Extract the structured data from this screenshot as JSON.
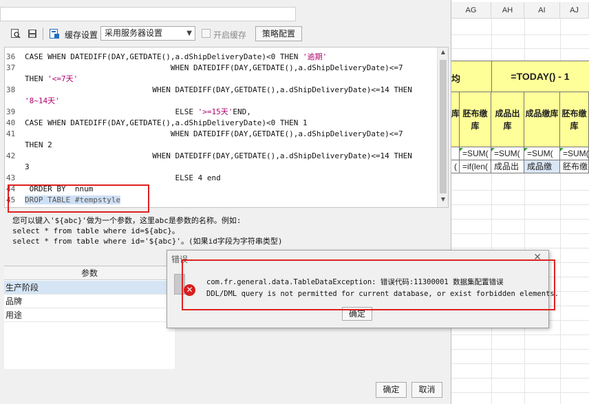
{
  "spreadsheet": {
    "columns": [
      "AG",
      "AH",
      "AI",
      "AJ"
    ],
    "merged_header_left": "均",
    "merged_header_right": "=TODAY() - 1",
    "header_cells": [
      "库",
      "胚布缴库",
      "成品出库",
      "成品缴库",
      "胚布缴库"
    ],
    "formula_row": [
      "",
      "=SUM(",
      "=SUM(",
      "=SUM(",
      "=SUM("
    ],
    "formula_row2": [
      "(",
      "=if(len(",
      "成品出",
      "成品缴",
      "胚布缴"
    ]
  },
  "toolbar": {
    "cache_label": "缓存设置",
    "cache_select": "采用服务器设置",
    "enable_cache_label": "开启缓存",
    "strategy_button": "策略配置"
  },
  "editor": {
    "lines": [
      {
        "n": "36",
        "text": "CASE WHEN DATEDIFF(DAY,GETDATE(),a.dShipDeliveryDate)<0 THEN ",
        "str": "'逾期'"
      },
      {
        "n": "37",
        "text": "                                WHEN DATEDIFF(DAY,GETDATE(),a.dShipDeliveryDate)<=7",
        "str": ""
      },
      {
        "n": "",
        "text": "THEN ",
        "str": "'<=7天'"
      },
      {
        "n": "38",
        "text": "                            WHEN DATEDIFF(DAY,GETDATE(),a.dShipDeliveryDate)<=14 THEN",
        "str": ""
      },
      {
        "n": "",
        "text": "",
        "str": "'8~14天'"
      },
      {
        "n": "39",
        "text": "                                 ELSE ",
        "str": "'>=15天'",
        "after": "END,"
      },
      {
        "n": "40",
        "text": "CASE WHEN DATEDIFF(DAY,GETDATE(),a.dShipDeliveryDate)<0 THEN 1",
        "str": ""
      },
      {
        "n": "41",
        "text": "                                WHEN DATEDIFF(DAY,GETDATE(),a.dShipDeliveryDate)<=7",
        "str": ""
      },
      {
        "n": "",
        "text": "THEN 2",
        "str": ""
      },
      {
        "n": "42",
        "text": "                            WHEN DATEDIFF(DAY,GETDATE(),a.dShipDeliveryDate)<=14 THEN",
        "str": ""
      },
      {
        "n": "",
        "text": "3",
        "str": ""
      },
      {
        "n": "43",
        "text": "                                 ELSE 4 end",
        "str": ""
      },
      {
        "n": "44",
        "text": " ORDER BY  nnum",
        "str": ""
      },
      {
        "n": "45",
        "text": "DROP TABLE #tempstyle",
        "str": "",
        "selected": true
      }
    ]
  },
  "hint": {
    "line1": "您可以键入'${abc}'做为一个参数，这里abc是参数的名称。例如:",
    "line2": "select * from table where id=${abc}。",
    "line3": "select * from table where id='${abc}'。(如果id字段为字符串类型)"
  },
  "params": {
    "header": "参数",
    "rows": [
      "生产阶段",
      "品牌",
      "用途"
    ]
  },
  "buttons": {
    "confirm": "确定",
    "cancel": "取消"
  },
  "error_dialog": {
    "title": "错误",
    "line1": "com.fr.general.data.TableDataException: 错误代码:11300001 数据集配置错误",
    "line2": "DDL/DML query is not permitted for current database, or exist forbidden elements.",
    "ok": "确定"
  }
}
